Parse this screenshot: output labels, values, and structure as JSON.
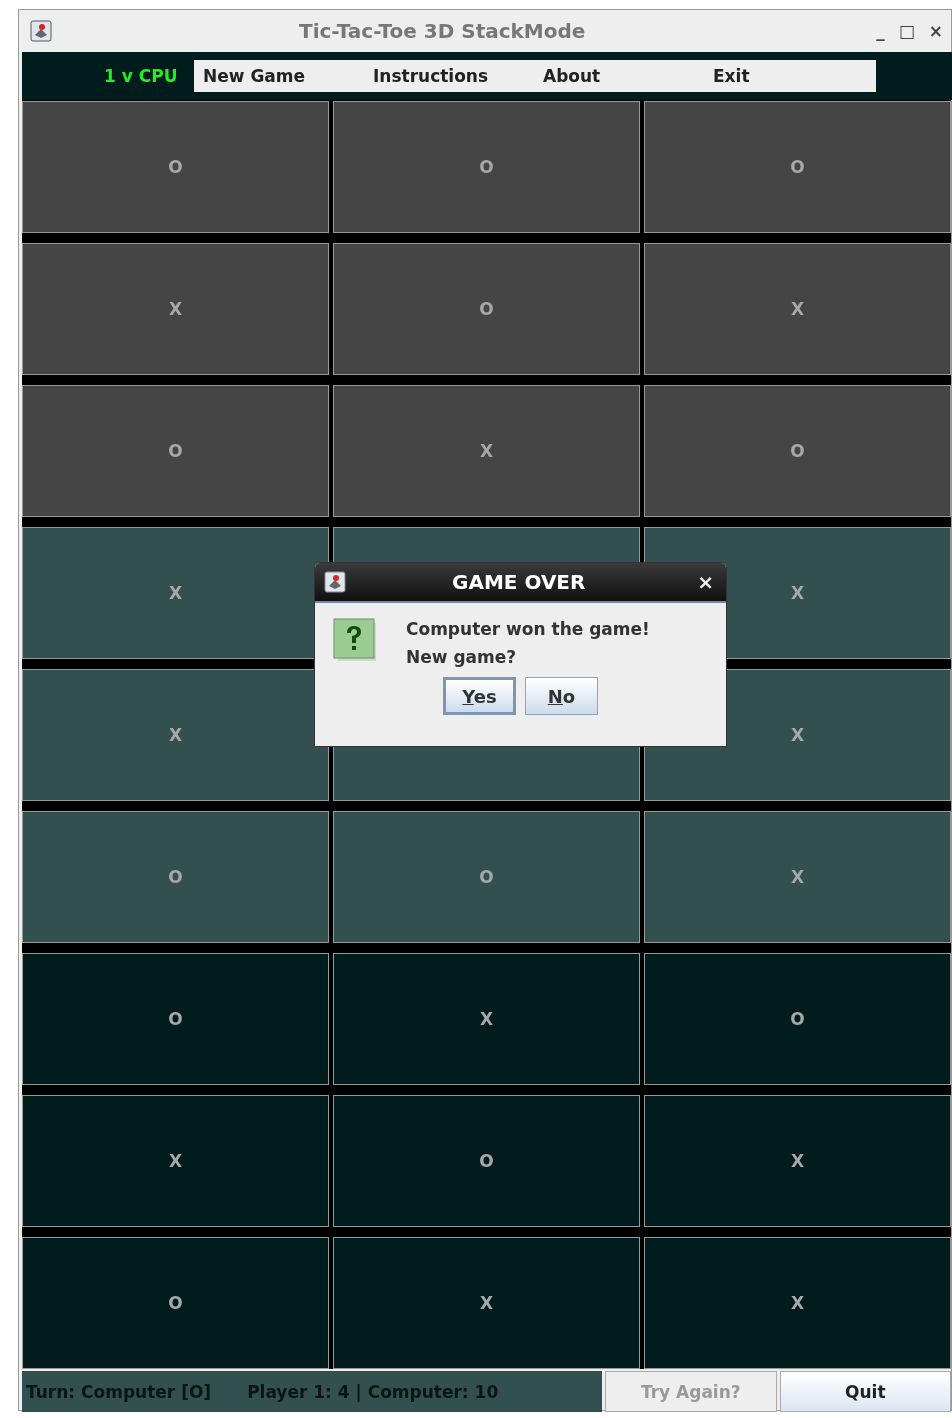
{
  "window": {
    "title": "Tic-Tac-Toe 3D StackMode",
    "controls": [
      "_",
      "□",
      "×"
    ]
  },
  "mode_label": "1 v CPU",
  "menu": [
    "New Game",
    "Instructions",
    "About",
    "Exit"
  ],
  "layers": [
    {
      "color": "#454545",
      "rows": [
        [
          "O",
          "O",
          "O"
        ],
        [
          "X",
          "O",
          "X"
        ],
        [
          "O",
          "X",
          "O"
        ]
      ]
    },
    {
      "color": "#335050",
      "rows": [
        [
          "X",
          null,
          "X"
        ],
        [
          "X",
          null,
          "X"
        ],
        [
          "O",
          "O",
          "X"
        ]
      ]
    },
    {
      "color": "#001c1c",
      "rows": [
        [
          "O",
          "X",
          "O"
        ],
        [
          "X",
          "O",
          "X"
        ],
        [
          "O",
          "X",
          "X"
        ]
      ]
    }
  ],
  "status_bar": {
    "turn": "Turn: Computer [O]",
    "score": "Player 1: 4 | Computer: 10",
    "buttons": [
      {
        "label": "Try Again?",
        "disabled": true
      },
      {
        "label": "Quit",
        "disabled": false
      }
    ]
  },
  "dialog": {
    "title": "GAME OVER",
    "close": "×",
    "message": [
      "Computer won the game!",
      "New game?"
    ],
    "buttons": [
      {
        "label": "Yes",
        "selected": true
      },
      {
        "label": "No",
        "selected": false
      }
    ]
  }
}
